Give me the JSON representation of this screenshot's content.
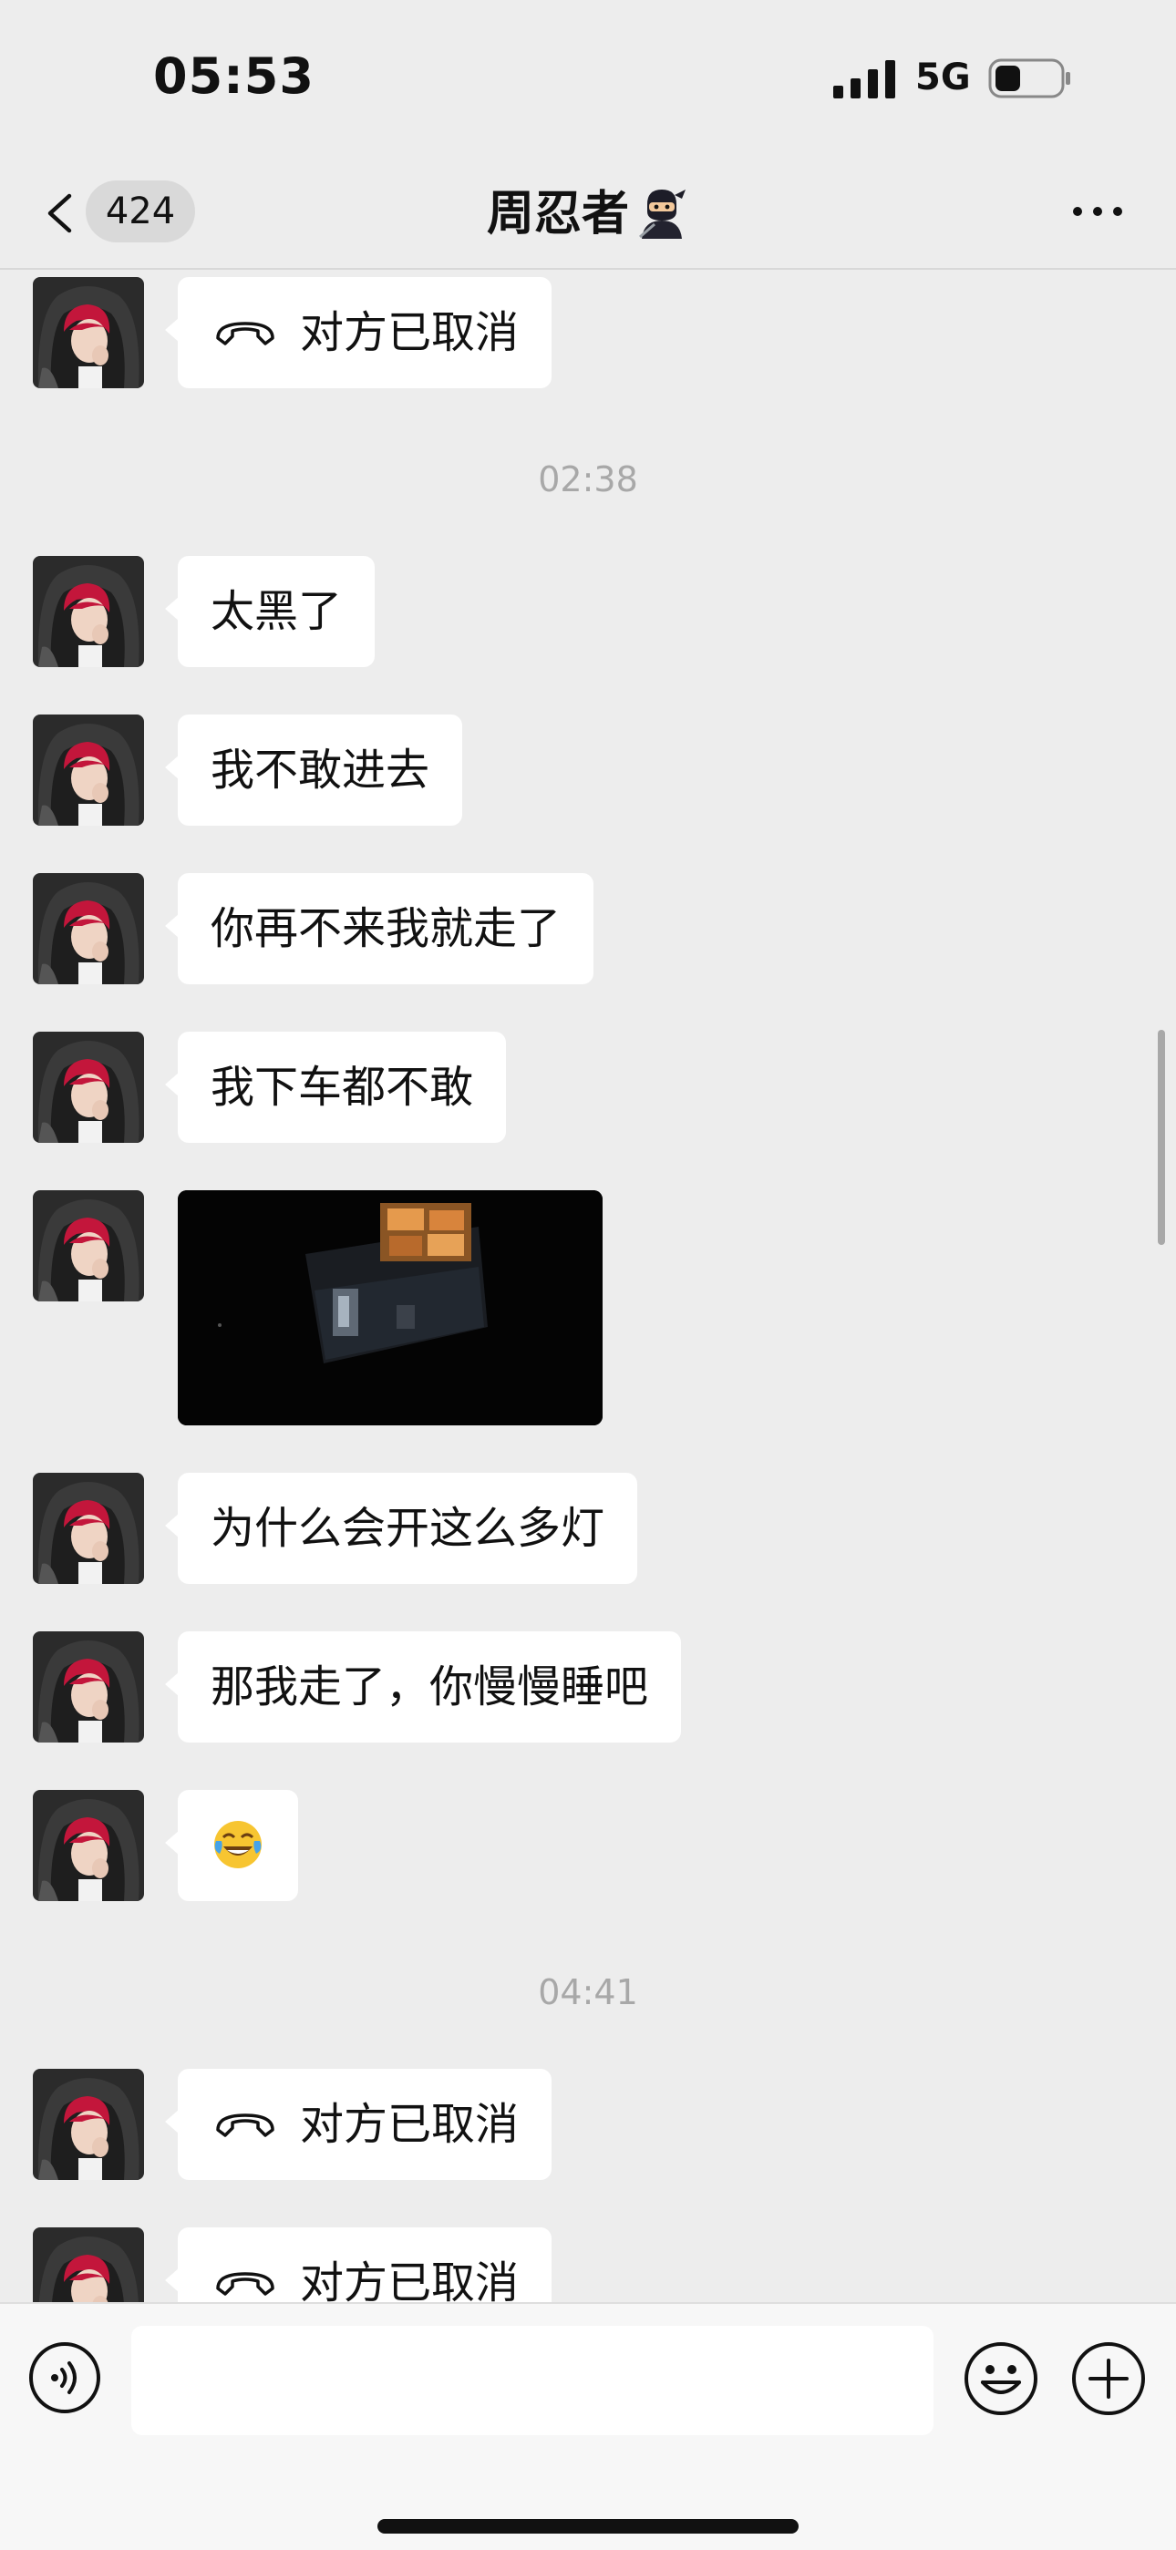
{
  "status_bar": {
    "time": "05:53",
    "network": "5G",
    "battery_level": 0.4,
    "signal_bars": 4
  },
  "nav": {
    "unread_count": "424",
    "title": "周忍者",
    "title_icon": "ninja-icon"
  },
  "messages": [
    {
      "type": "call",
      "text": "对方已取消",
      "icon": "phone-hangup-icon"
    },
    {
      "type": "time",
      "text": "02:38"
    },
    {
      "type": "text",
      "text": "太黑了"
    },
    {
      "type": "text",
      "text": "我不敢进去"
    },
    {
      "type": "text",
      "text": "你再不来我就走了"
    },
    {
      "type": "text",
      "text": "我下车都不敢"
    },
    {
      "type": "image",
      "description_icon": "night-photo"
    },
    {
      "type": "text",
      "text": "为什么会开这么多灯"
    },
    {
      "type": "text",
      "text": "那我走了，你慢慢睡吧"
    },
    {
      "type": "emoji",
      "icon": "tears-of-joy-emoji-icon"
    },
    {
      "type": "time",
      "text": "04:41"
    },
    {
      "type": "call",
      "text": "对方已取消",
      "icon": "phone-hangup-icon"
    },
    {
      "type": "call",
      "text": "对方已取消",
      "icon": "phone-hangup-icon"
    }
  ],
  "input": {
    "value": "",
    "placeholder": ""
  },
  "colors": {
    "background": "#ededed",
    "bubble": "#ffffff",
    "timestamp": "#a8a8a8",
    "avatar_hair": "#c3163b"
  }
}
